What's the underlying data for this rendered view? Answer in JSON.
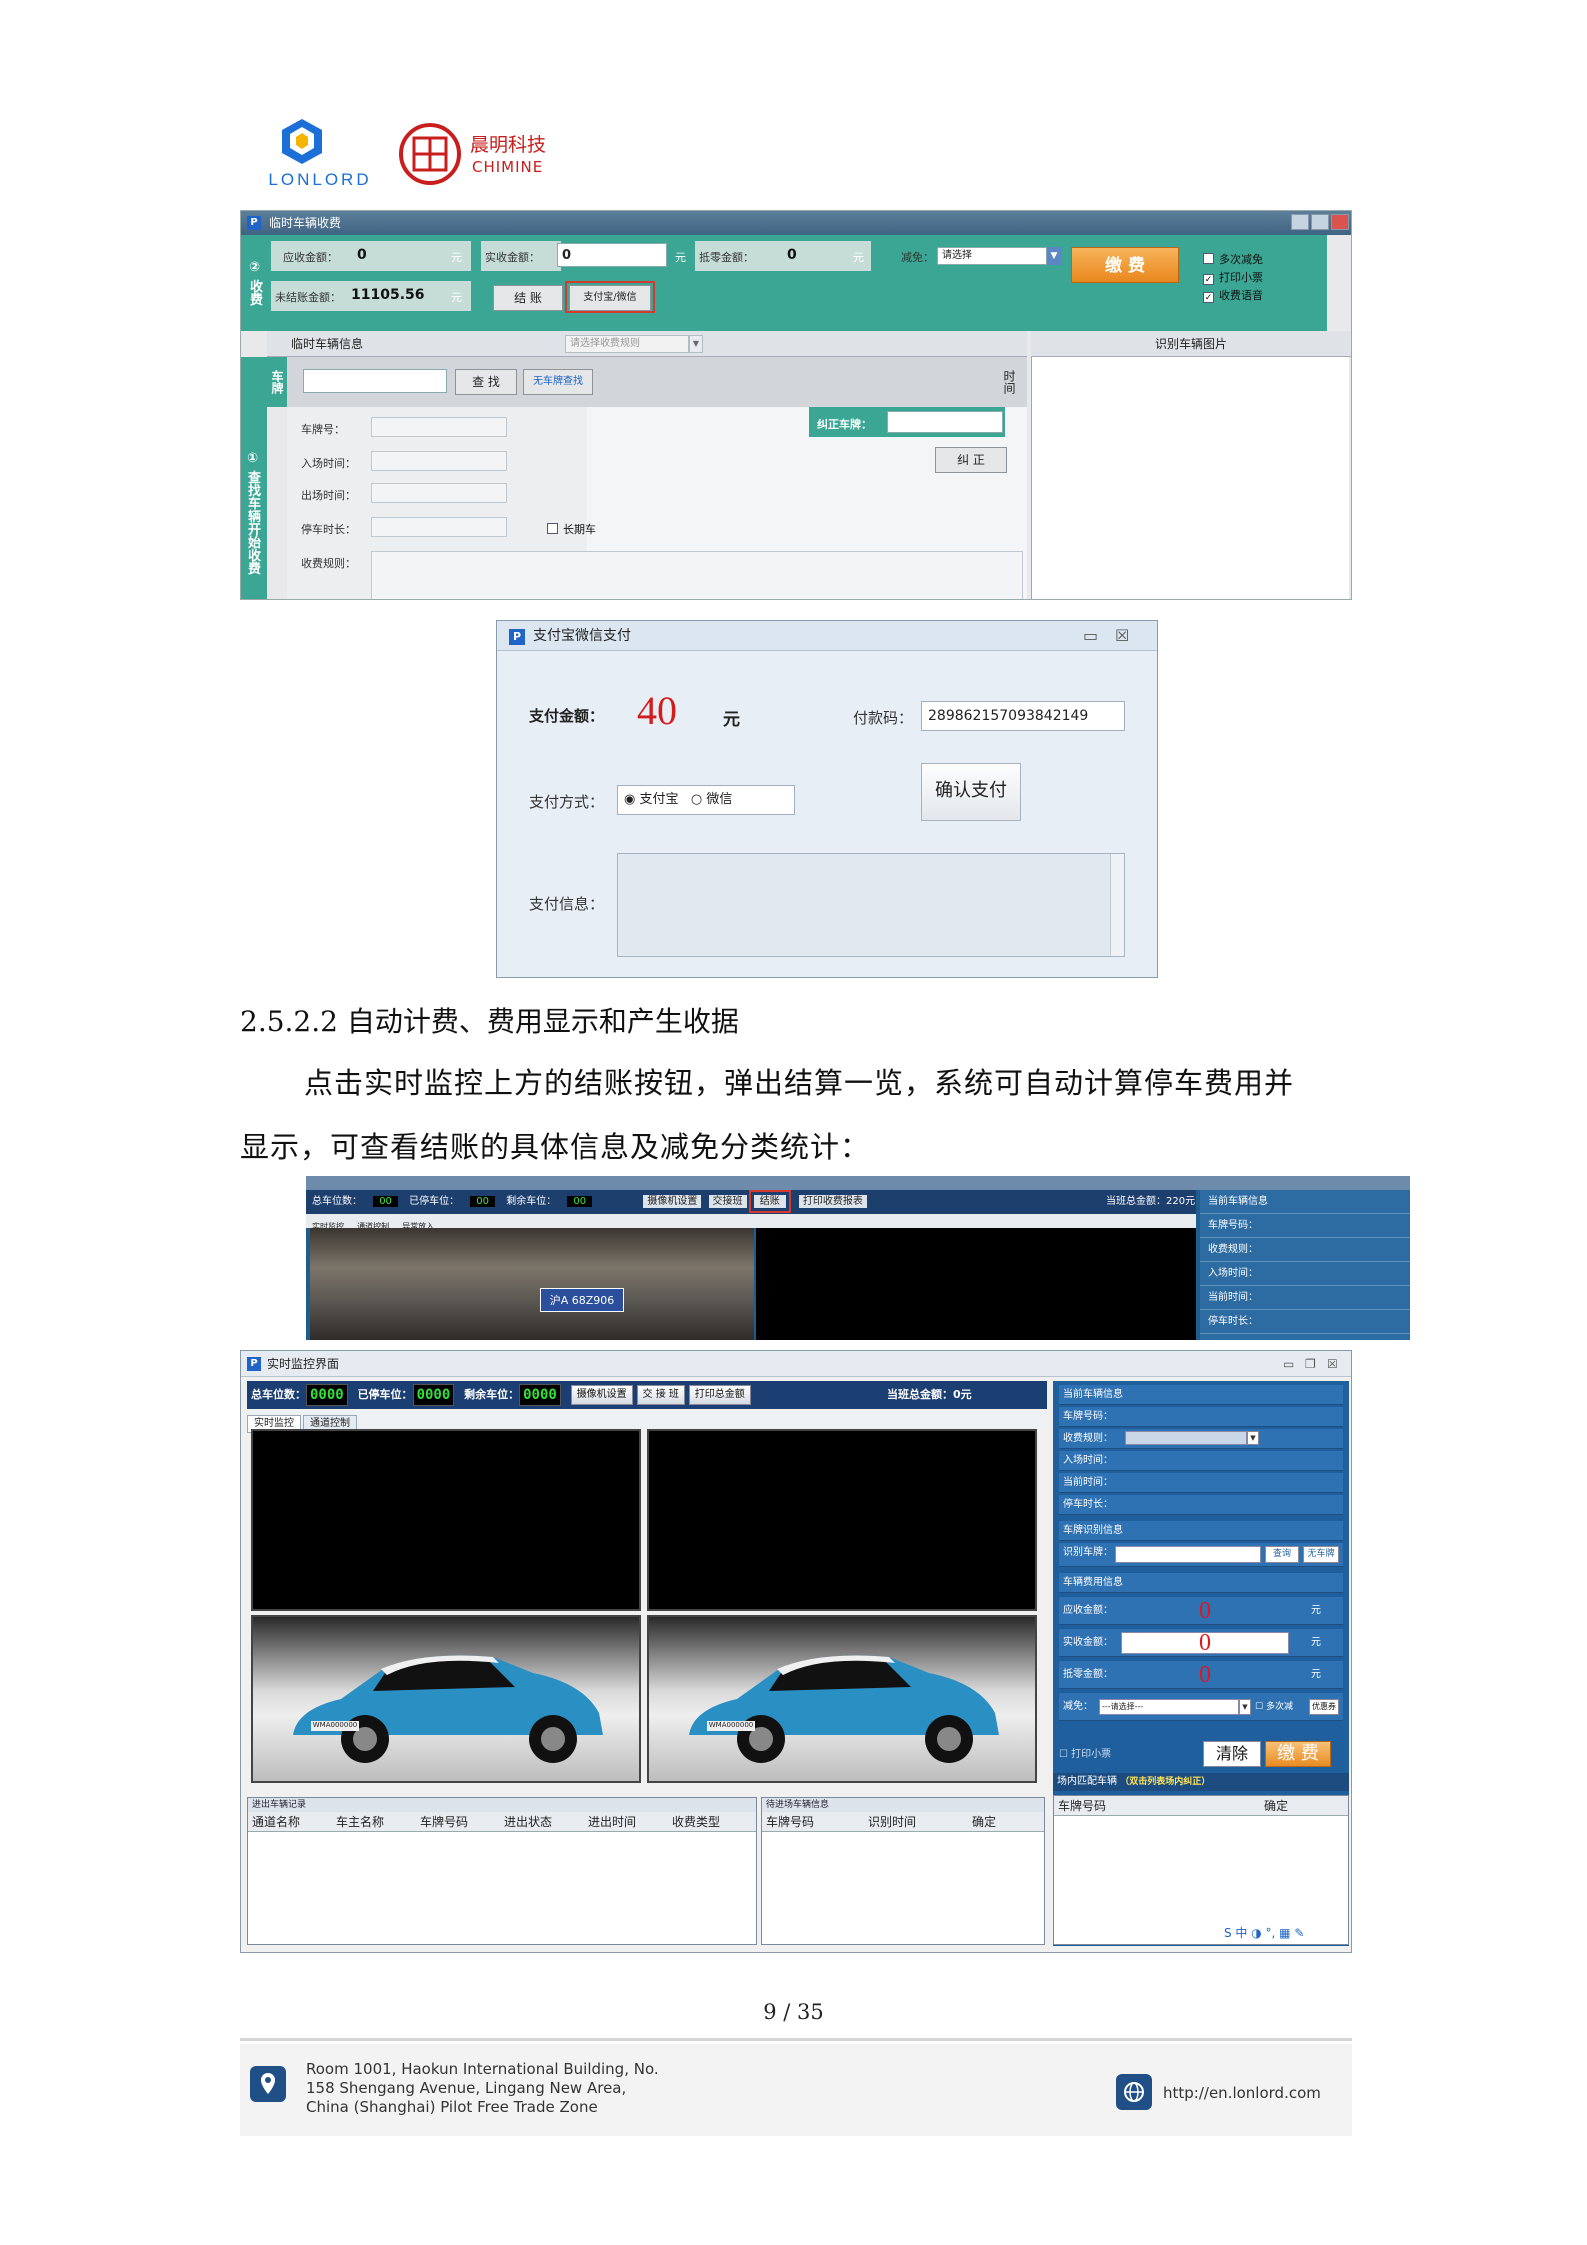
{
  "header": {
    "logo1_text": "LONLORD",
    "logo2_cn": "晨明科技",
    "logo2_en": "CHIMINE",
    "colors": {
      "lonlord_blue": "#1b6fd6",
      "lonlord_yellow": "#f5b400",
      "chimine_red": "#c81e1e"
    }
  },
  "shot1": {
    "title": "临时车辆收费",
    "side_label": "② 收费",
    "row1": {
      "receivable_label": "应收金额：",
      "receivable_value": "0",
      "unit1": "元",
      "actual_label": "实收金额：",
      "actual_value": "0",
      "unit2": "元",
      "discount_label": "抵零金额：",
      "discount_value": "0",
      "unit3": "元",
      "reduce_label": "减免：",
      "reduce_value": "请选择"
    },
    "row2": {
      "unsettled_label": "未结账金额：",
      "unsettled_value": "11105.56",
      "unit": "元",
      "settle_button": "结 账",
      "alipay_button": "支付宝/微信"
    },
    "pay_button": "缴 费",
    "checks": [
      "多次减免",
      "打印小票",
      "收费语音"
    ],
    "section_left": "临时车辆信息",
    "section_combo": "请选择收费规则",
    "section_right": "识别车辆图片",
    "plate_side": "车牌",
    "search_button": "查 找",
    "no_plate_button": "无车牌查找",
    "time_col": "时间",
    "vertical_label": "① 查找车辆开始收费",
    "fields": [
      "车牌号：",
      "入场时间：",
      "出场时间：",
      "停车时长：",
      "收费规则："
    ],
    "long_term": "长期车",
    "correct_label": "纠正车牌：",
    "correct_button": "纠 正"
  },
  "shot2": {
    "title": "支付宝微信支付",
    "amount_label": "支付金额：",
    "amount_value": "40",
    "amount_unit": "元",
    "code_label": "付款码：",
    "code_value": "289862157093842149",
    "method_label": "支付方式：",
    "method_alipay": "支付宝",
    "method_wechat": "微信",
    "confirm_button": "确认支付",
    "info_label": "支付信息："
  },
  "text": {
    "heading": "2.5.2.2 自动计费、费用显示和产生收据",
    "para_line1": "点击实时监控上方的结账按钮，弹出结算一览，系统可自动计算停车费用并",
    "para_line2": "显示，可查看结账的具体信息及减免分类统计："
  },
  "shot3": {
    "bar_items": [
      "总车位数：",
      "已停车位：",
      "剩余车位：",
      "摄像机设置",
      "交接班",
      "结账",
      "打印收费报表"
    ],
    "total_label": "当班总金额：220元",
    "tabs": [
      "实时监控",
      "通道控制",
      "异常放入"
    ],
    "plate": "沪A 68Z906",
    "panel_rows": [
      "当前车辆信息",
      "车牌号码：",
      "收费规则：",
      "入场时间：",
      "当前时间：",
      "停车时长："
    ]
  },
  "shot4": {
    "title": "实时监控界面",
    "bar": {
      "total_label": "总车位数：",
      "total_value": "0000",
      "used_label": "已停车位：",
      "used_value": "0000",
      "left_label": "剩余车位：",
      "left_value": "0000",
      "camera_btn": "摄像机设置",
      "shift_btn": "交 接 班",
      "print_btn": "打印总金额",
      "total_amount": "当班总金额：0元"
    },
    "tabs": [
      "实时监控",
      "通道控制"
    ],
    "plate_text": "WMA000000",
    "right_rows": [
      "当前车辆信息",
      "车牌号码：",
      "收费规则：",
      "入场时间：",
      "当前时间：",
      "停车时长：",
      "车牌识别信息"
    ],
    "recog_label": "识别车牌：",
    "query_btn": "查询",
    "noplate_btn": "无车牌",
    "fee_title": "车辆费用信息",
    "fee_rows": [
      {
        "label": "应收金额：",
        "value": "0",
        "unit": "元"
      },
      {
        "label": "实收金额：",
        "value": "0",
        "unit": "元"
      },
      {
        "label": "抵零金额：",
        "value": "0",
        "unit": "元"
      }
    ],
    "reduce_label": "减免：",
    "reduce_value": "---请选择---",
    "multi_reduce": "多次减",
    "coupon_btn": "优惠券",
    "print_ticket": "打印小票",
    "clear_btn": "清除",
    "pay_btn": "缴 费",
    "out_caption": "进出车辆记录",
    "out_cols": [
      "通道名称",
      "车主名称",
      "车牌号码",
      "进出状态",
      "进出时间",
      "收费类型"
    ],
    "wait_caption": "待进场车辆信息",
    "wait_cols": [
      "车牌号码",
      "识别时间",
      "确定"
    ],
    "match_caption": "场内匹配车辆",
    "match_hint": "（双击列表场内纠正）",
    "match_cols": [
      "车牌号码",
      "确定"
    ],
    "ime_text": "S 中 ◑ °, ▦ ✎"
  },
  "footer": {
    "page_number": "9 / 35",
    "address_line1": "Room 1001, Haokun International Building, No.",
    "address_line2": "158 Shengang Avenue, Lingang New Area,",
    "address_line3": "China (Shanghai) Pilot Free Trade Zone",
    "url": "http://en.lonlord.com"
  }
}
